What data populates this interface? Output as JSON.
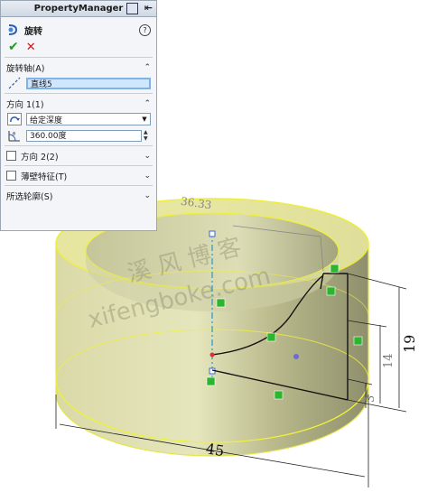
{
  "panel": {
    "title": "PropertyManager",
    "feature_name": "旋转",
    "help": "?",
    "ok_symbol": "✔",
    "cancel_symbol": "✕"
  },
  "axis_group": {
    "label": "旋转轴(A)",
    "value": "直线5"
  },
  "direction1": {
    "label": "方向 1(1)",
    "type_value": "给定深度",
    "angle_value": "360.00度"
  },
  "direction2": {
    "label": "方向 2(2)"
  },
  "thin_feature": {
    "label": "薄壁特征(T)"
  },
  "selected_contours": {
    "label": "所选轮廓(S)"
  },
  "dimensions": {
    "diameter": "45",
    "height": "19",
    "dim_14": "14",
    "dim_3": "3",
    "dim_top": "36.33"
  },
  "watermark": {
    "line1": "溪 风 博 客",
    "line2": "xifengboke.com"
  },
  "colors": {
    "edge_yellow": "#f0f03c",
    "relation_green": "#2db52d",
    "sketch_blue": "#3b66d8",
    "axis_cyan": "#1e9ad6"
  }
}
